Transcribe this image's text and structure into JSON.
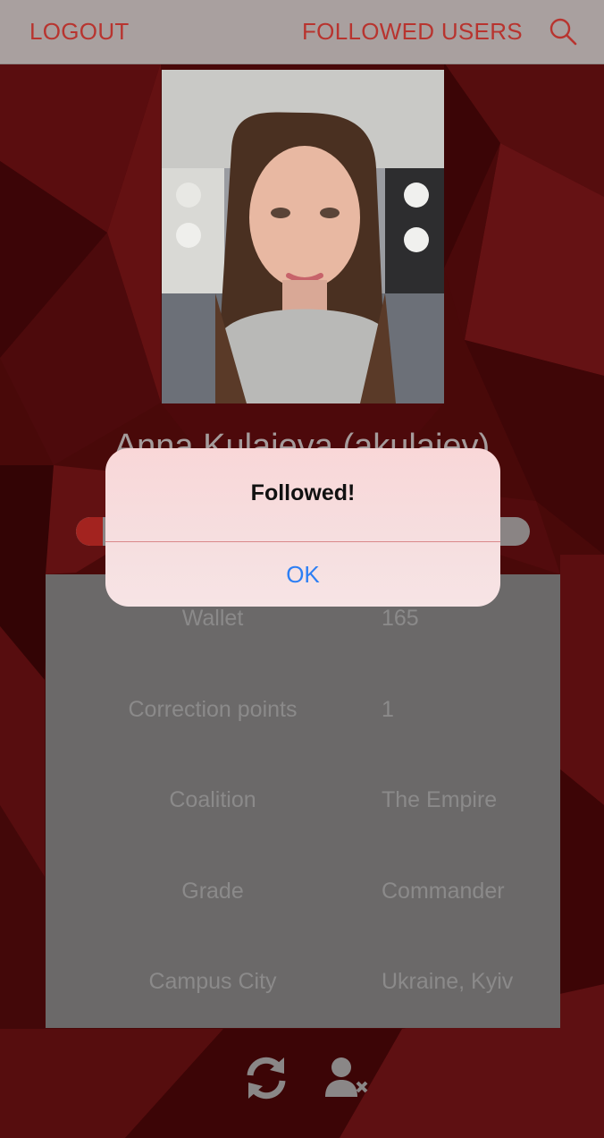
{
  "navbar": {
    "logout_label": "LOGOUT",
    "followed_label": "FOLLOWED USERS",
    "search_icon": "search-icon"
  },
  "profile": {
    "name": "Anna Kulaieva (akulaiev)",
    "level_progress_fraction": 0.06
  },
  "info": {
    "rows": [
      {
        "key": "Wallet",
        "value": "165"
      },
      {
        "key": "Correction points",
        "value": "1"
      },
      {
        "key": "Coalition",
        "value": "The Empire"
      },
      {
        "key": "Grade",
        "value": "Commander"
      },
      {
        "key": "Campus City",
        "value": "Ukraine, Kyiv"
      }
    ]
  },
  "actions": {
    "refresh_icon": "refresh-icon",
    "unfollow_icon": "unfollow-user-icon"
  },
  "alert": {
    "title": "Followed!",
    "ok_label": "OK"
  },
  "colors": {
    "accent": "#b8342f",
    "alert_button": "#2d7ff4",
    "background": "#5c0a0c"
  }
}
